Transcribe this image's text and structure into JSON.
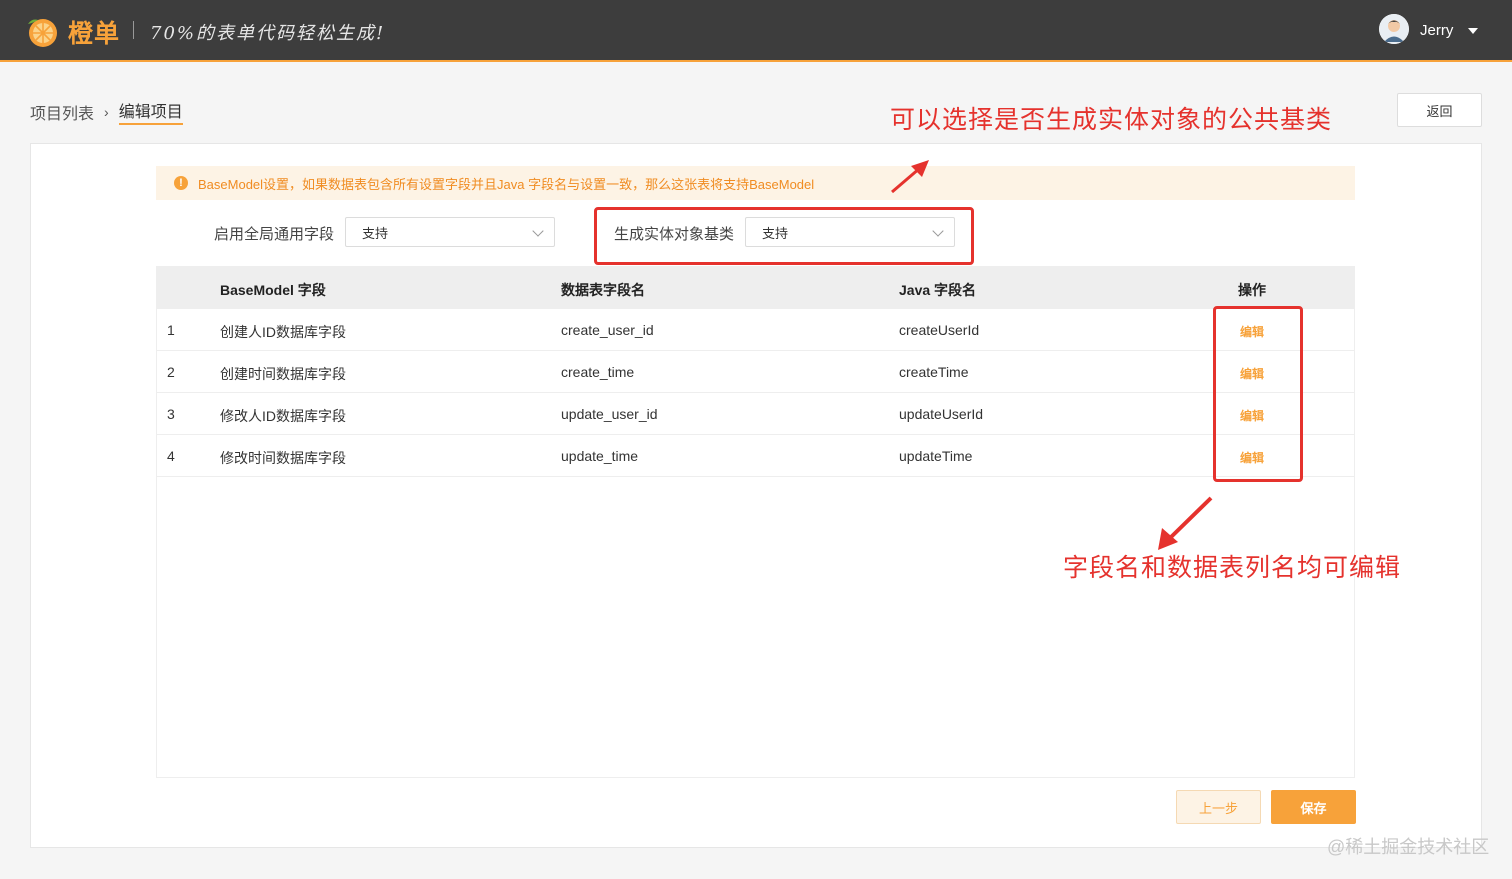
{
  "header": {
    "brand": "橙单",
    "slogan": "70%的表单代码轻松生成!",
    "username": "Jerry"
  },
  "breadcrumb": {
    "parent": "项目列表",
    "separator": "›",
    "current": "编辑项目"
  },
  "back_button": "返回",
  "notice": {
    "icon": "!",
    "text": "BaseModel设置，如果数据表包含所有设置字段并且Java 字段名与设置一致，那么这张表将支持BaseModel"
  },
  "form": {
    "global_fields_label": "启用全局通用字段",
    "global_fields_value": "支持",
    "base_class_label": "生成实体对象基类",
    "base_class_value": "支持"
  },
  "table": {
    "columns": [
      "",
      "BaseModel 字段",
      "数据表字段名",
      "Java 字段名",
      "操作"
    ],
    "rows": [
      {
        "index": "1",
        "field": "创建人ID数据库字段",
        "column": "create_user_id",
        "java": "createUserId",
        "action": "编辑"
      },
      {
        "index": "2",
        "field": "创建时间数据库字段",
        "column": "create_time",
        "java": "createTime",
        "action": "编辑"
      },
      {
        "index": "3",
        "field": "修改人ID数据库字段",
        "column": "update_user_id",
        "java": "updateUserId",
        "action": "编辑"
      },
      {
        "index": "4",
        "field": "修改时间数据库字段",
        "column": "update_time",
        "java": "updateTime",
        "action": "编辑"
      }
    ]
  },
  "footer": {
    "prev_label": "上一步",
    "save_label": "保存"
  },
  "annotations": {
    "top": "可以选择是否生成实体对象的公共基类",
    "bottom": "字段名和数据表列名均可编辑"
  },
  "watermark": "@稀土掘金技术社区",
  "colors": {
    "accent": "#f7a23a",
    "topbar": "#3d3d3d",
    "annotation": "#e5322d"
  }
}
